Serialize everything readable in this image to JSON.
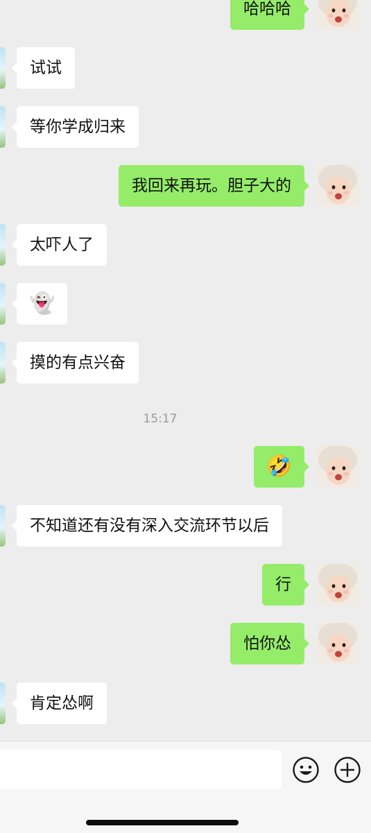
{
  "conversation": {
    "messages": [
      {
        "side": "right",
        "text": "哈哈哈"
      },
      {
        "side": "left",
        "text": "试试"
      },
      {
        "side": "left",
        "text": "等你学成归来"
      },
      {
        "side": "right",
        "text": "我回来再玩。胆子大的"
      },
      {
        "side": "left",
        "text": "太吓人了"
      },
      {
        "side": "left",
        "text": "👻"
      },
      {
        "side": "left",
        "text": "摸的有点兴奋"
      },
      {
        "side": "right",
        "text": "🤣"
      },
      {
        "side": "left",
        "text": "不知道还有没有深入交流环节以后"
      },
      {
        "side": "right",
        "text": "行"
      },
      {
        "side": "right",
        "text": "怕你怂"
      },
      {
        "side": "left",
        "text": "肯定怂啊"
      }
    ],
    "timestamp": "15:17"
  },
  "input_bar": {
    "placeholder": "",
    "emoji_icon": "smiley-face-icon",
    "add_icon": "plus-circle-icon"
  },
  "colors": {
    "background": "#ededed",
    "incoming_bubble": "#ffffff",
    "outgoing_bubble": "#95ec69"
  }
}
